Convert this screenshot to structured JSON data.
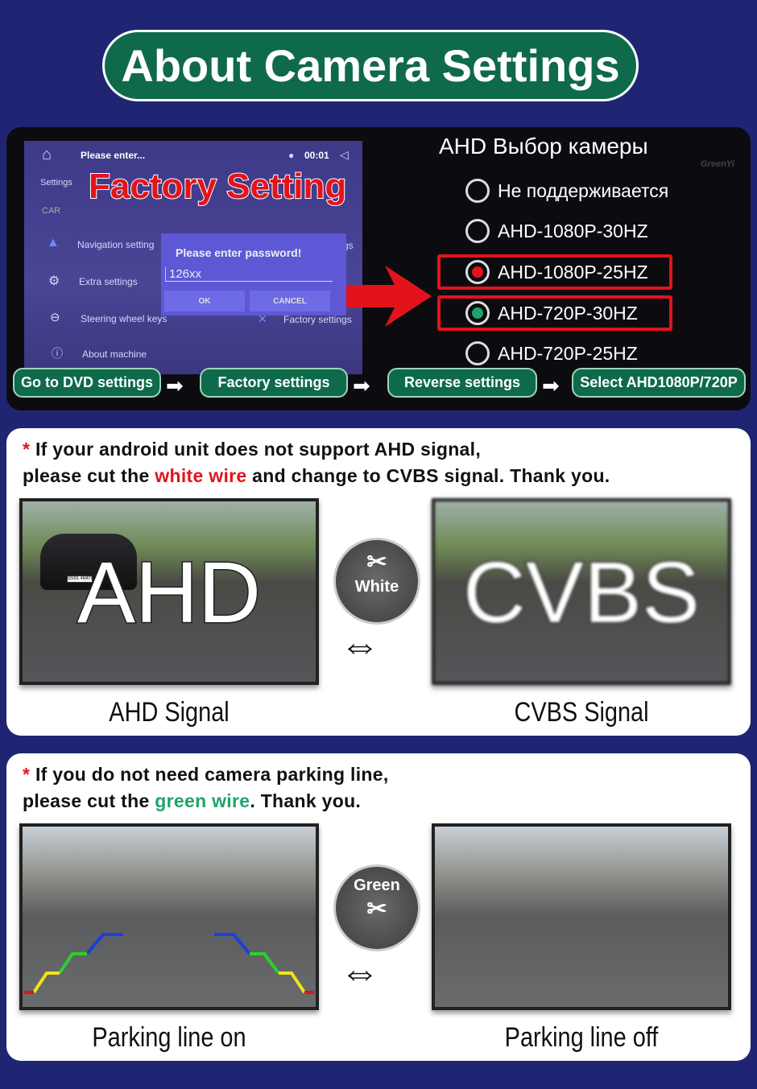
{
  "title": "About Camera Settings",
  "screen": {
    "header": "Please enter...",
    "time": "00:01",
    "side_settings": "Settings",
    "side_car": "CAR",
    "items": [
      "Navigation setting",
      "Extra settings",
      "Steering wheel keys",
      "About machine"
    ],
    "right_items": [
      "ttings",
      "Factory settings"
    ],
    "overlay": "Factory Setting",
    "dialog": {
      "title": "Please enter password!",
      "value": "126xx",
      "ok": "OK",
      "cancel": "CANCEL"
    }
  },
  "ahd": {
    "title": "AHD Выбор камеры",
    "watermark": "GreenYi",
    "options": [
      {
        "label": "Не поддерживается",
        "selected": false
      },
      {
        "label": "AHD-1080P-30HZ",
        "selected": false
      },
      {
        "label": "AHD-1080P-25HZ",
        "selected": true,
        "dot": "#e3131b"
      },
      {
        "label": "AHD-720P-30HZ",
        "selected": true,
        "dot": "#1fa46a"
      },
      {
        "label": "AHD-720P-25HZ",
        "selected": false
      }
    ]
  },
  "steps": [
    "Go to DVD settings",
    "Factory settings",
    "Reverse settings",
    "Select AHD1080P/720P"
  ],
  "section1": {
    "star": "*",
    "line1": " If your android unit does not support AHD signal,",
    "line2a": "please cut the ",
    "highlight": "white wire",
    "line2b": " and change to CVBS signal. Thank you.",
    "left_overlay": "AHD",
    "right_overlay": "CVBS",
    "left_caption": "AHD Signal",
    "right_caption": "CVBS Signal",
    "wire_label": "White",
    "plate": "S500L 4MATIC"
  },
  "section2": {
    "star": "*",
    "line1": " If you do not need camera parking line,",
    "line2a": "please cut the ",
    "highlight": "green wire",
    "line2b": ". Thank you.",
    "left_caption": "Parking line on",
    "right_caption": "Parking line off",
    "wire_label": "Green"
  },
  "colors": {
    "background": "#1f2572",
    "brand_green": "#0e6a4a",
    "accent_red": "#e3131b",
    "wire_green": "#1fa46a"
  }
}
